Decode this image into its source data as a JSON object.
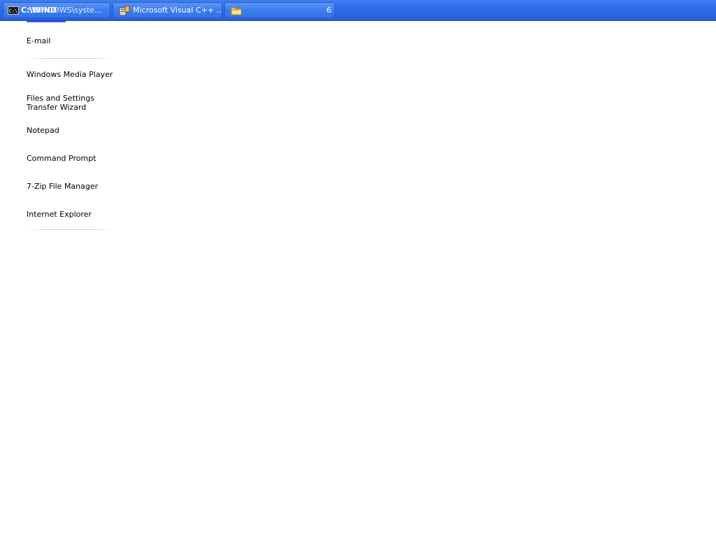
{
  "taskbar": {
    "buttons": [
      {
        "label": "C:\\WINDOWS\\syste...",
        "overlay": "C:\\WIND",
        "icon": "command-prompt-icon",
        "icon_text": "C:\\"
      },
      {
        "label": "Microsoft Visual C++ ...",
        "icon": "visual-cpp-icon"
      },
      {
        "label": "",
        "icon": "folder-icon",
        "count": "6"
      }
    ]
  },
  "menu": {
    "items": [
      {
        "label": "E-mail"
      },
      {
        "label": "Windows Media Player"
      },
      {
        "label": "Files and Settings Transfer Wizard"
      },
      {
        "label": "Notepad"
      },
      {
        "label": "Command Prompt"
      },
      {
        "label": "7-Zip File Manager"
      },
      {
        "label": "Internet Explorer"
      }
    ]
  },
  "colors": {
    "taskbar": "#2f6ae6",
    "button": "#3c7ef0",
    "background": "#ffffff"
  }
}
